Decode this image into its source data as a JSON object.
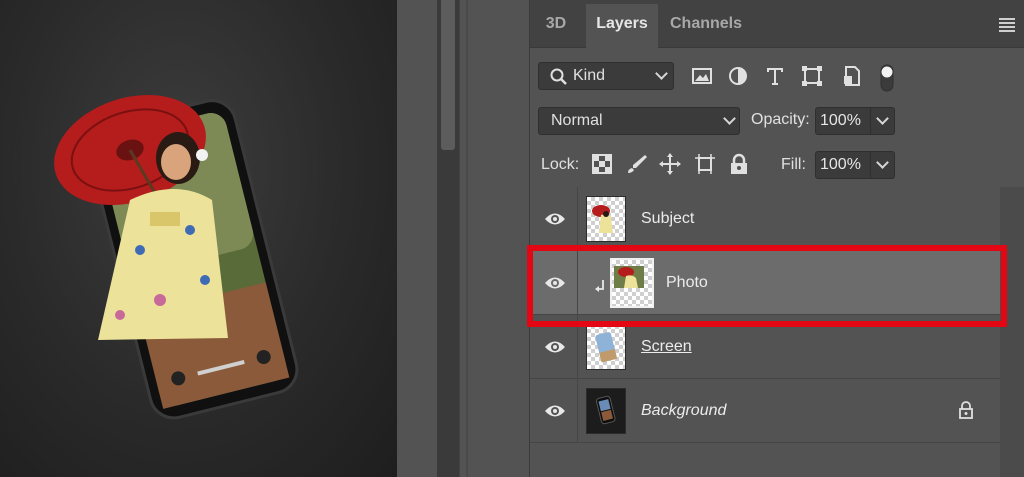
{
  "panel": {
    "tabs": [
      {
        "label": "3D",
        "active": false
      },
      {
        "label": "Layers",
        "active": true
      },
      {
        "label": "Channels",
        "active": false
      }
    ]
  },
  "filter": {
    "kind_label": "Kind",
    "icons": [
      "image-filter-icon",
      "adjustment-filter-icon",
      "type-filter-icon",
      "shape-filter-icon",
      "smart-object-filter-icon",
      "filter-toggle-icon"
    ]
  },
  "blend": {
    "mode": "Normal",
    "opacity_label": "Opacity:",
    "opacity_value": "100%"
  },
  "lock": {
    "label": "Lock:",
    "icons": [
      "lock-transparent-pixels-icon",
      "lock-image-pixels-icon",
      "lock-position-icon",
      "lock-artboard-icon",
      "lock-all-icon"
    ],
    "fill_label": "Fill:",
    "fill_value": "100%"
  },
  "layers": [
    {
      "name": "Subject",
      "visible": true,
      "selected": false,
      "clipped": false,
      "locked": false
    },
    {
      "name": "Photo",
      "visible": true,
      "selected": true,
      "clipped": true,
      "locked": false
    },
    {
      "name": "Screen",
      "visible": true,
      "selected": false,
      "clipped": false,
      "locked": false
    },
    {
      "name": "Background",
      "visible": true,
      "selected": false,
      "clipped": false,
      "locked": true
    }
  ],
  "colors": {
    "highlight": "#e30613",
    "panel_bg": "#535353",
    "selected_row": "#6c6c6c"
  }
}
